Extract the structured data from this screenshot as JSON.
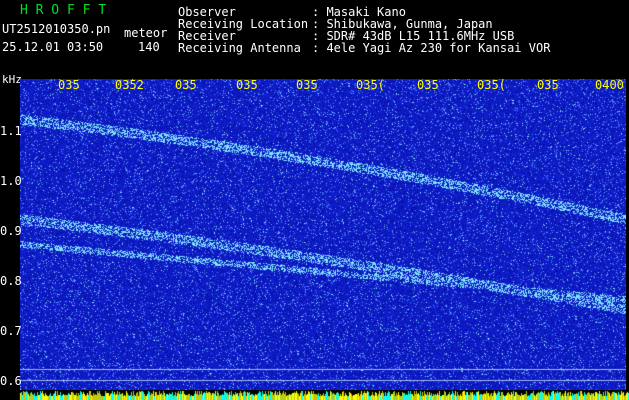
{
  "header": {
    "brand": "H R O F F T",
    "filename": "UT2512010350.pn",
    "tag": "meteor",
    "date": "25.12.01 03:50",
    "count": "140",
    "labels": [
      "Observer",
      "Receiving Location",
      "Receiver",
      "Receiving Antenna"
    ],
    "values": [
      ": Masaki Kano",
      ": Shibukawa, Gunma, Japan",
      ": SDR# 43dB L15 111.6MHz USB",
      ": 4ele Yagi Az 230 for Kansai VOR"
    ]
  },
  "axis": {
    "y_unit": "kHz",
    "y_ticks": [
      "1.1",
      "1.0",
      "0.9",
      "0.8",
      "0.7",
      "0.6"
    ],
    "x_ticks": [
      "035",
      "0352",
      "035",
      "035",
      "035",
      "035(",
      "035",
      "035(",
      "035",
      "0400"
    ]
  },
  "colors": {
    "background": "#000000",
    "spectrum_base": "#1f2fb0",
    "trace": "#8ff0ff",
    "header_green": "#00e020",
    "tick_yellow": "#ffff00",
    "level_bar_yellow": "#ffff00",
    "level_bar_cyan": "#00ffff"
  }
}
